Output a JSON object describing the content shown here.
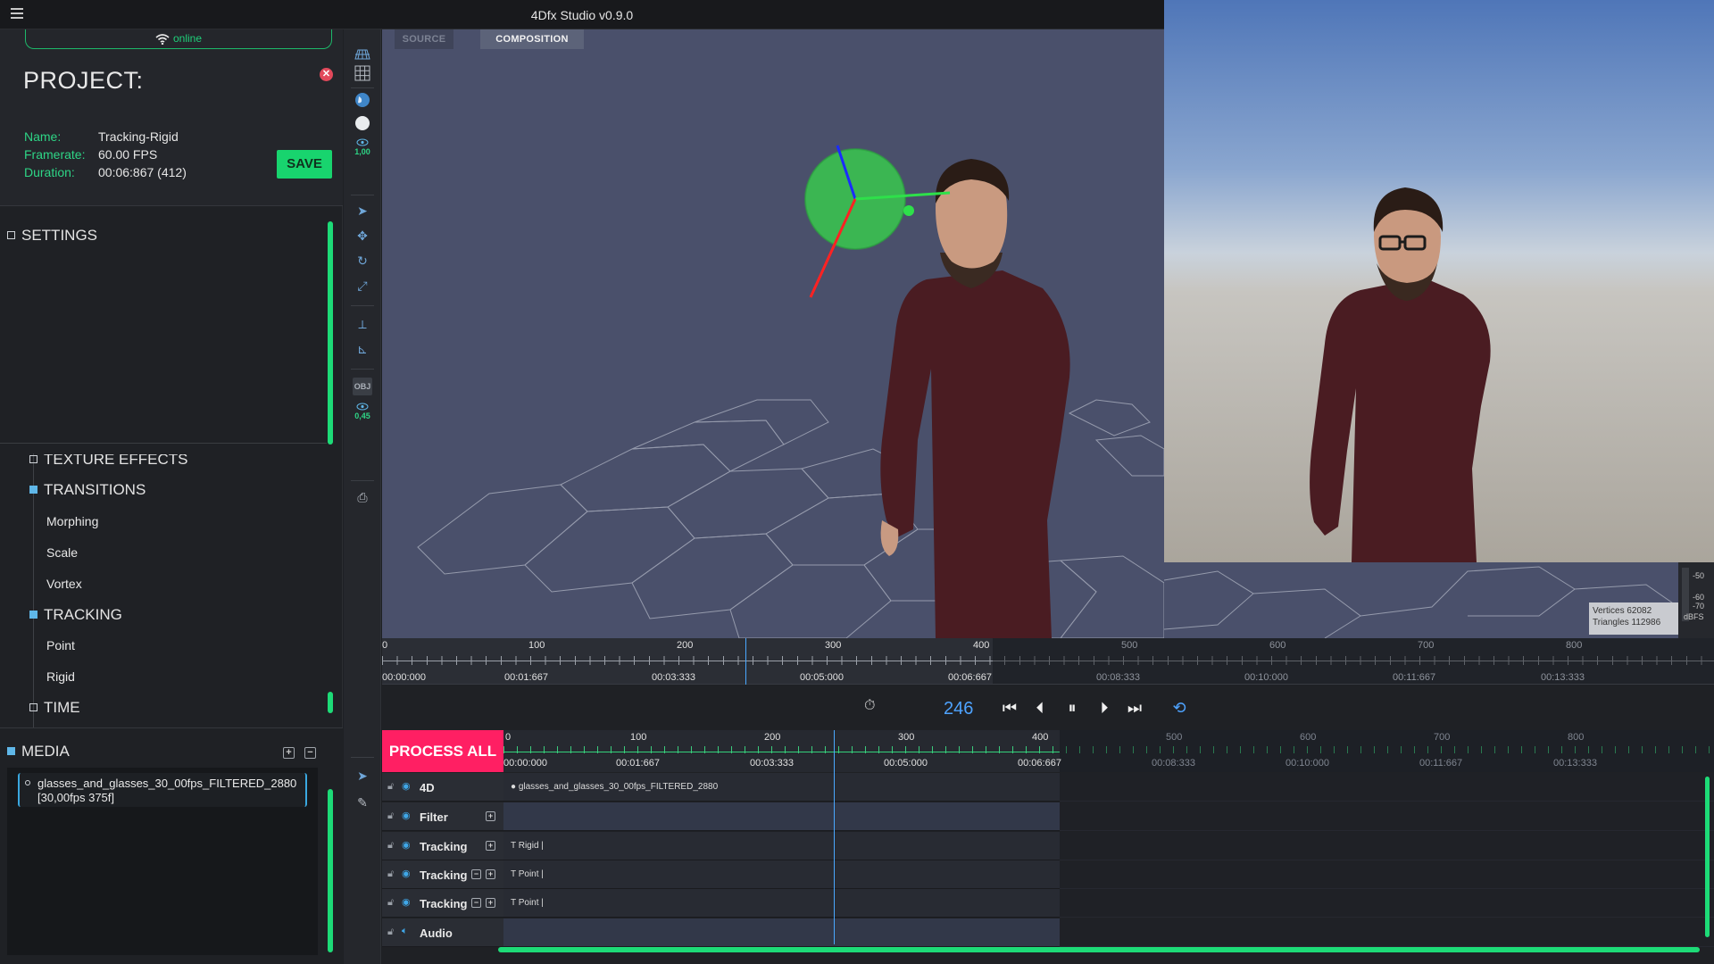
{
  "app": {
    "title": "4Dfx Studio v0.9.0"
  },
  "status": {
    "online_label": "online"
  },
  "project": {
    "title": "PROJECT:",
    "rows": [
      {
        "key": "Name:",
        "value": "Tracking-Rigid"
      },
      {
        "key": "Framerate:",
        "value": "60.00 FPS"
      },
      {
        "key": "Duration:",
        "value": "00:06:867 (412)"
      }
    ],
    "save_label": "SAVE"
  },
  "settings": {
    "header": "SETTINGS",
    "texture_effects": "TEXTURE EFFECTS",
    "transitions": {
      "label": "TRANSITIONS",
      "items": [
        "Morphing",
        "Scale",
        "Vortex"
      ]
    },
    "tracking": {
      "label": "TRACKING",
      "items": [
        "Point",
        "Rigid"
      ]
    },
    "time": "TIME"
  },
  "media": {
    "header": "MEDIA",
    "item_line1": "glasses_and_glasses_30_00fps_FILTERED_2880",
    "item_line2": "[30,00fps 375f]"
  },
  "tools": {
    "opacity_a": "1,00",
    "obj_label": "OBJ",
    "opacity_b": "0,45"
  },
  "viewport": {
    "tabs": {
      "source": "SOURCE",
      "composition": "COMPOSITION"
    },
    "stats": {
      "vertices": "Vertices 62082",
      "triangles": "Triangles 112986"
    },
    "meter": {
      "labels": [
        "-50",
        "-60",
        "-70"
      ],
      "unit": "dBFS"
    }
  },
  "ruler_top": {
    "numbers": [
      "0",
      "100",
      "200",
      "300",
      "400",
      "500",
      "600",
      "700",
      "800"
    ],
    "times": [
      "00:00:000",
      "00:01:667",
      "00:03:333",
      "00:05:000",
      "00:06:667",
      "00:08:333",
      "00:10:000",
      "00:11:667",
      "00:13:333"
    ]
  },
  "transport": {
    "frame": "246"
  },
  "timeline": {
    "process_all": "PROCESS ALL",
    "numbers": [
      "0",
      "100",
      "200",
      "300",
      "400",
      "500",
      "600",
      "700",
      "800"
    ],
    "times": [
      "00:00:000",
      "00:01:667",
      "00:03:333",
      "00:05:000",
      "00:06:667",
      "00:08:333",
      "00:10:000",
      "00:11:667",
      "00:13:333"
    ],
    "tracks": [
      {
        "name": "4D",
        "clip": "glasses_and_glasses_30_00fps_FILTERED_2880"
      },
      {
        "name": "Filter",
        "clip": ""
      },
      {
        "name": "Tracking",
        "clip": "Rigid |"
      },
      {
        "name": "Tracking",
        "clip": "Point |"
      },
      {
        "name": "Tracking",
        "clip": "Point |"
      },
      {
        "name": "Audio",
        "clip": ""
      }
    ]
  },
  "colors": {
    "accent_green": "#18d46e",
    "accent_blue": "#4ea3ff",
    "process_pink": "#ff1f63",
    "viewport_bg": "#4a506b"
  }
}
